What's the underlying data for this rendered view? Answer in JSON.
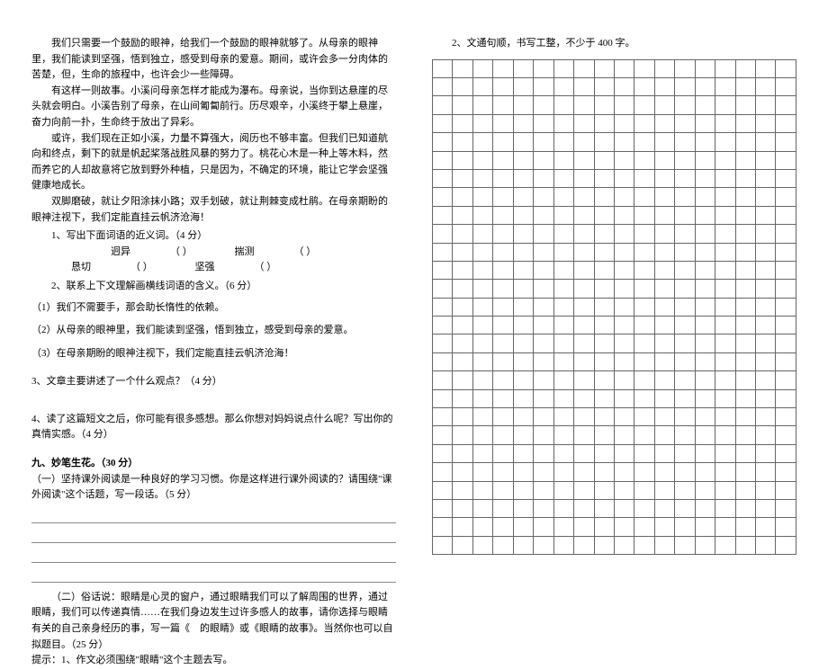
{
  "left": {
    "passage": {
      "p1": "我们只需要一个鼓励的眼神，给我们一个鼓励的眼神就够了。从母亲的眼神里，我们能读到坚强，悟到独立，感受到母亲的爱意。期间，或许会多一分肉体的苦楚，但，生命的旅程中，也许会少一些障碍。",
      "p2": "有这样一则故事。小溪问母亲怎样才能成为瀑布。母亲说，当你到达悬崖的尽头就会明白。小溪告别了母亲，在山间匍匐前行。历尽艰辛，小溪终于攀上悬崖，奋力向前一扑，生命终于放出了异彩。",
      "p3": "或许，我们现在正如小溪，力量不算强大，阅历也不够丰富。但我们已知道航向和终点，剩下的就是帆起桨落战胜风暴的努力了。桃花心木是一种上等木料，然而养它的人却故意将它放到野外种植，只是因为，不确定的环境，能让它学会坚强健康地成长。",
      "p4": "双脚磨破，就让夕阳涂抹小路；双手划破，就让荆棘变成杜鹃。在母亲期盼的眼神注视下，我们定能直挂云帆济沧海！"
    },
    "q1": {
      "label": "1、写出下面词语的近义词。（4 分）",
      "items": [
        {
          "word": "迥异",
          "paren": "（          ）"
        },
        {
          "word": "揣测",
          "paren": "（          ）"
        },
        {
          "word": "恳切",
          "paren": "（          ）"
        },
        {
          "word": "坚强",
          "paren": "（          ）"
        }
      ]
    },
    "q2": {
      "label": "2、联系上下文理解画横线词语的含义。（6 分）",
      "sub1": "（1）我们不需要手，那会助长惰性的依赖。",
      "sub2": "（2）从母亲的眼神里，我们能读到坚强，悟到独立，感受到母亲的爱意。",
      "sub3": "（3）在母亲期盼的眼神注视下，我们定能直挂云帆济沧海！"
    },
    "q3": "3、文章主要讲述了一个什么观点？（4 分）",
    "q4": "4、读了这篇短文之后，你可能有很多感想。那么你想对妈妈说点什么呢？写出你的真情实感。（4 分）",
    "section9": {
      "title": "九、妙笔生花。（30 分）",
      "part1": "（一）坚持课外阅读是一种良好的学习习惯。你是这样进行课外阅读的？请围绕\"课外阅读\"这个话题，写一段话。（5 分）",
      "part2": "（二）俗话说：眼睛是心灵的窗户，通过眼睛我们可以了解周围的世界，通过眼睛，我们可以传递真情……在我们身边发生过许多感人的故事，请你选择与眼睛有关的自己亲身经历的事，写一篇《　的眼睛》或《眼睛的故事》。当然你也可以自拟题目。（25 分）",
      "tip1": "提示：1、作文必须围绕\"眼睛\"这个主题去写。"
    }
  },
  "right": {
    "tip2": "2、文通句顺，书写工整，不少于 400 字。"
  },
  "grid": {
    "rows": 27,
    "cols": 18
  }
}
